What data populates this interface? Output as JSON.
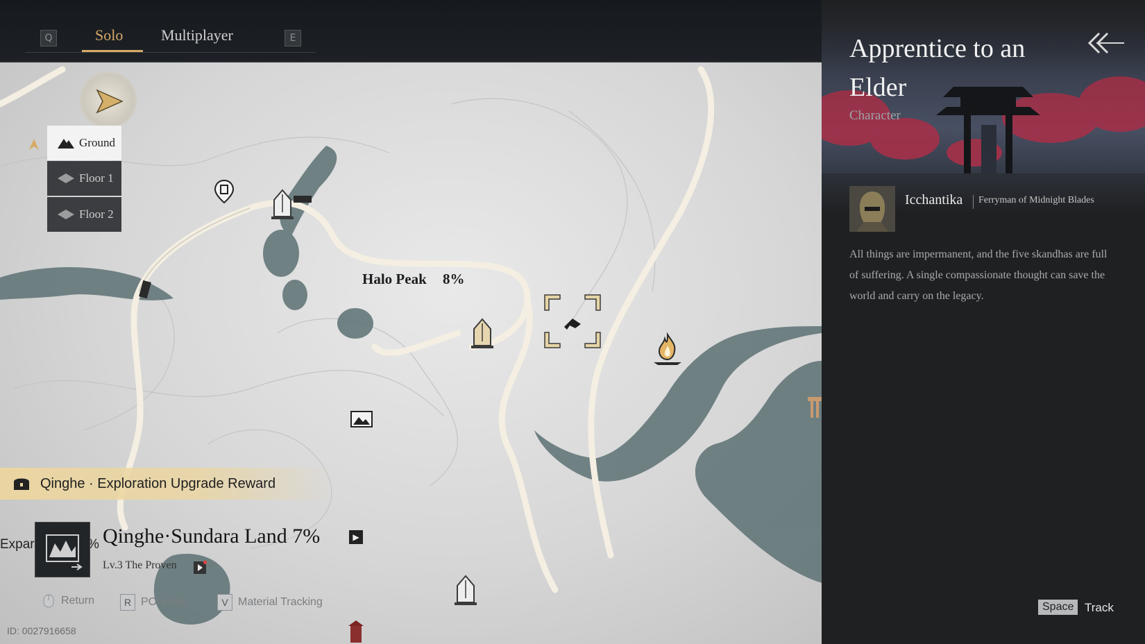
{
  "topbar": {
    "key_left": "Q",
    "tabs": [
      {
        "label": "Solo",
        "active": true
      },
      {
        "label": "Multiplayer",
        "active": false
      }
    ],
    "key_right": "E"
  },
  "floors": [
    {
      "label": "Ground",
      "icon": "mountain-icon",
      "active": true
    },
    {
      "label": "Floor 1",
      "icon": "diamond-icon",
      "active": false
    },
    {
      "label": "Floor 2",
      "icon": "diamond-icon",
      "active": false
    }
  ],
  "map": {
    "area_label": "Halo Peak",
    "area_percent": "8%",
    "markers": [
      "waypoint-icon",
      "relic-stone-icon",
      "campfire-icon",
      "landscape-icon",
      "target-icon",
      "gate-marker-icon",
      "player-arrow-icon"
    ]
  },
  "reward_banner": {
    "text": "Qinghe · Exploration Upgrade Reward",
    "icon": "chest-icon"
  },
  "region": {
    "partial_left": "Expar",
    "partial_percent": "%",
    "name": "Qinghe·Sundara Land 7%",
    "level": "Lv.3 The Proven"
  },
  "hints": [
    {
      "key": "",
      "label": "Return",
      "icon": "mouse-icon"
    },
    {
      "key": "R",
      "label": "POI Filter"
    },
    {
      "key": "V",
      "label": "Material Tracking"
    }
  ],
  "map_id": "ID: 0027916658",
  "panel": {
    "title": "Apprentice to an Elder",
    "type": "Character",
    "npc_name": "Icchantika",
    "npc_role": "Ferryman of Midnight Blades",
    "description": "All things are impermanent, and the five skandhas are full of suffering. A single compassionate thought can save the world and carry on the legacy.",
    "track_key": "Space",
    "track_label": "Track"
  },
  "colors": {
    "accent": "#d7a966",
    "panel_bg": "#1f2022",
    "banner": "#ecd6a0",
    "water": "#4f6266"
  }
}
